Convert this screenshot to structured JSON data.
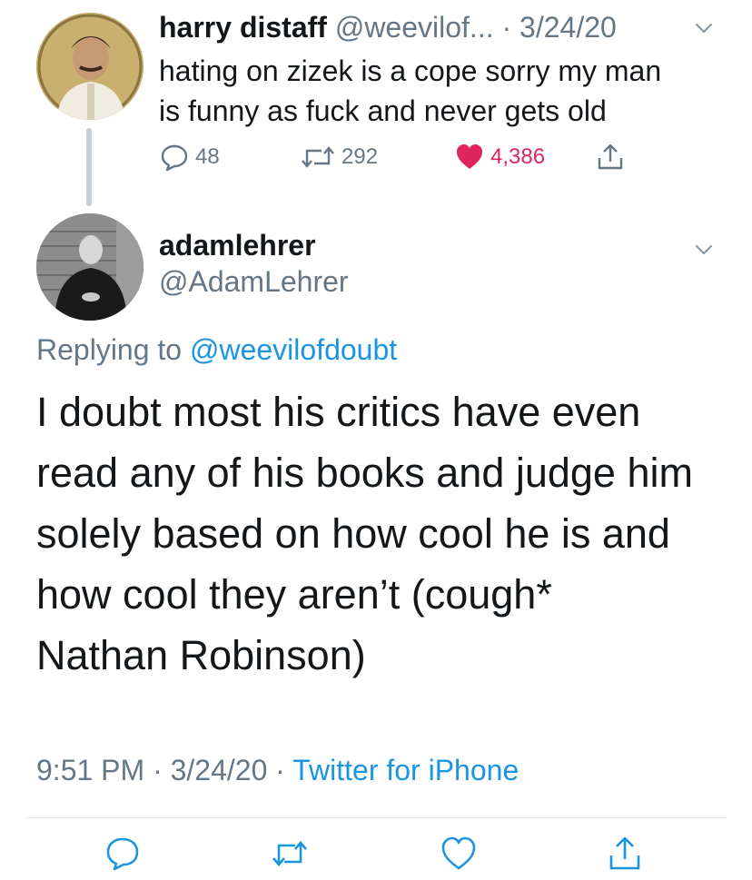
{
  "parent_tweet": {
    "name": "harry distaff",
    "handle": "@weevilof...",
    "date": "· 3/24/20",
    "text_lines": [
      "hating on zizek is a cope sorry my man",
      "is funny as fuck and never gets old"
    ],
    "replies": "48",
    "retweets": "292",
    "likes": "4,386",
    "icons": [
      "reply-icon",
      "retweet-icon",
      "heart-icon",
      "share-icon",
      "chevron-down-icon"
    ],
    "like_color": "#e0245e"
  },
  "reply_tweet": {
    "name": "adamlehrer",
    "handle": "@AdamLehrer",
    "replying_prefix": "Replying to ",
    "replying_to": "@weevilofdoubt",
    "text_lines": [
      "I doubt most his critics have even",
      "read any of his books and judge him",
      "solely based on how cool he is and",
      "how cool they aren’t (cough*",
      "Nathan Robinson)"
    ],
    "time": "9:51 PM",
    "separator": " · ",
    "date": "3/24/20",
    "source": "Twitter for iPhone"
  },
  "colors": {
    "text": "#14171a",
    "secondary": "#657786",
    "link": "#1b95e0",
    "thread_line": "#c4cfd6"
  }
}
